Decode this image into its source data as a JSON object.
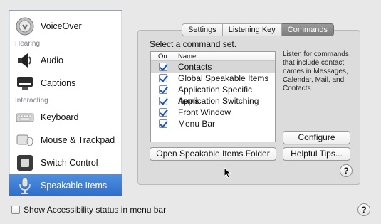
{
  "sidebar": {
    "items": [
      {
        "id": "voiceover",
        "label": "VoiceOver",
        "icon": "voiceover-icon"
      },
      {
        "id": "audio",
        "label": "Audio",
        "icon": "speaker-icon"
      },
      {
        "id": "captions",
        "label": "Captions",
        "icon": "captions-icon"
      },
      {
        "id": "keyboard",
        "label": "Keyboard",
        "icon": "keyboard-icon"
      },
      {
        "id": "mouse-trackpad",
        "label": "Mouse & Trackpad",
        "icon": "mouse-icon"
      },
      {
        "id": "switch-control",
        "label": "Switch Control",
        "icon": "switch-control-icon"
      },
      {
        "id": "speakable-items",
        "label": "Speakable Items",
        "icon": "microphone-icon",
        "selected": true
      }
    ],
    "headers": {
      "hearing": "Hearing",
      "interacting": "Interacting"
    }
  },
  "tabs": [
    {
      "label": "Settings"
    },
    {
      "label": "Listening Key"
    },
    {
      "label": "Commands",
      "active": true
    }
  ],
  "main": {
    "prompt": "Select a command set.",
    "columns": {
      "on": "On",
      "name": "Name"
    },
    "command_sets": [
      {
        "label": "Contacts",
        "checked": true,
        "selected": true
      },
      {
        "label": "Global Speakable Items",
        "checked": true
      },
      {
        "label": "Application Specific Items",
        "checked": true
      },
      {
        "label": "Application Switching",
        "checked": true
      },
      {
        "label": "Front Window",
        "checked": true
      },
      {
        "label": "Menu Bar",
        "checked": true
      }
    ],
    "description": "Listen for commands that include contact names in Messages, Calendar, Mail, and Contacts.",
    "configure_label": "Configure",
    "open_folder_label": "Open Speakable Items Folder",
    "helpful_tips_label": "Helpful Tips...",
    "help_glyph": "?"
  },
  "footer": {
    "show_status_label": "Show Accessibility status in menu bar",
    "show_status_checked": false,
    "help_glyph": "?"
  },
  "colors": {
    "selection": "#2f6cc8",
    "active_tab": "#7c7c7c",
    "checkmark": "#1c4fb3"
  }
}
